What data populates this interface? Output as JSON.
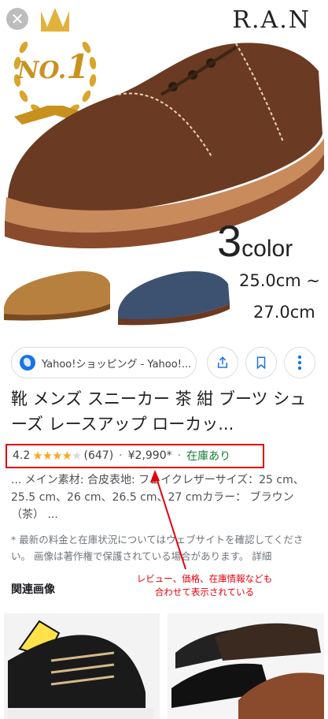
{
  "hero": {
    "brand": "R.A.N",
    "badge_prefix": "NO.",
    "badge_num": "1",
    "color_count_num": "3",
    "color_count_word": "color",
    "size_from": "25.0cm ~",
    "size_to": "27.0cm"
  },
  "close_glyph": "✕",
  "source": {
    "label": "Yahoo!ショッピング - Yahoo!..."
  },
  "actions": [
    "share-icon",
    "bookmark-icon",
    "more-vert-icon"
  ],
  "title": "靴 メンズ スニーカー 茶 紺 ブーツ シューズ レースアップ ローカッ...",
  "rating": {
    "value": "4.2",
    "stars": 4.2,
    "count": "(647)"
  },
  "price": "¥2,990*",
  "stock": "在庫あり",
  "separator": "·",
  "description": "... メイン素材: 合皮表地: フェイクレザーサイズ：25 cm、25.5 cm、26 cm、26.5 cm、27 cmカラー： ブラウン （茶） ...",
  "notice": "* 最新の料金と在庫状況についてはウェブサイトを確認してください。 画像は著作権で保護されている場合があります。 詳細",
  "related_heading": "関連画像",
  "annotation": {
    "line1": "レビュー、価格、在庫情報なども",
    "line2": "合わせて表示されている"
  },
  "colors": {
    "highlight": "#e3000b",
    "stock_green": "#188038",
    "star": "#f9a825",
    "link_blue": "#1a73e8"
  }
}
